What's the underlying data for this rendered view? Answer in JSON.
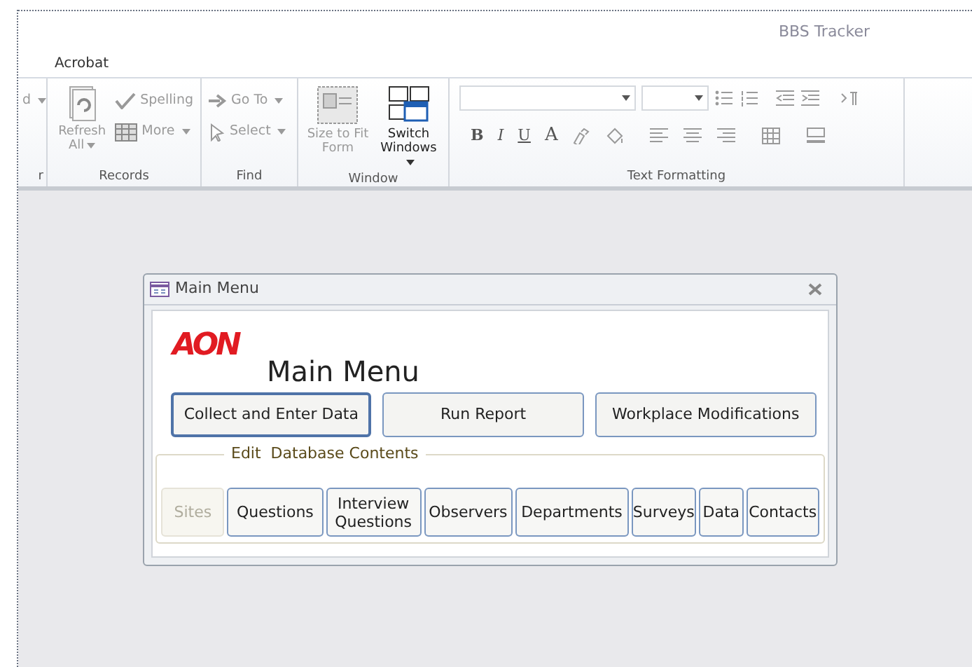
{
  "app": {
    "title": "BBS Tracker"
  },
  "tabs": [
    {
      "label": "Acrobat",
      "selected": false
    }
  ],
  "ribbon": {
    "groups": [
      {
        "label": "r",
        "items": [
          {
            "kind": "small",
            "label": "d",
            "dropdown": true,
            "disabled": true
          }
        ]
      },
      {
        "label": "Records",
        "items": [
          {
            "kind": "large",
            "label": "Refresh All",
            "dropdown": true,
            "disabled": true
          },
          {
            "kind": "small",
            "label": "Spelling",
            "dropdown": false,
            "disabled": true
          },
          {
            "kind": "small",
            "label": "More",
            "dropdown": true,
            "disabled": true
          }
        ]
      },
      {
        "label": "Find",
        "items": [
          {
            "kind": "small",
            "label": "Go To",
            "dropdown": true,
            "disabled": true
          },
          {
            "kind": "small",
            "label": "Select",
            "dropdown": true,
            "disabled": true
          }
        ]
      },
      {
        "label": "Window",
        "items": [
          {
            "kind": "large",
            "label": "Size to Fit Form",
            "dropdown": false,
            "disabled": true
          },
          {
            "kind": "large",
            "label": "Switch Windows",
            "dropdown": true,
            "disabled": false
          }
        ]
      },
      {
        "label": "Text Formatting",
        "items": [
          {
            "kind": "formatting",
            "buttons": [
              "B",
              "I",
              "U",
              "A"
            ],
            "disabled": true
          }
        ]
      }
    ]
  },
  "dialog": {
    "title": "Main Menu",
    "logo": "AON",
    "heading": "Main Menu",
    "buttons": [
      {
        "label": "Collect and Enter Data",
        "focused": true
      },
      {
        "label": "Run Report",
        "focused": false
      },
      {
        "label": "Workplace Modifications",
        "focused": false
      }
    ],
    "frame": {
      "label": "Edit  Database Contents",
      "buttons": [
        {
          "label": "Sites",
          "disabled": true
        },
        {
          "label": "Questions",
          "disabled": false
        },
        {
          "label": "Interview Questions",
          "disabled": false
        },
        {
          "label": "Observers",
          "disabled": false
        },
        {
          "label": "Departments",
          "disabled": false
        },
        {
          "label": "Surveys",
          "disabled": false
        },
        {
          "label": "Data",
          "disabled": false
        },
        {
          "label": "Contacts",
          "disabled": false
        }
      ]
    }
  }
}
